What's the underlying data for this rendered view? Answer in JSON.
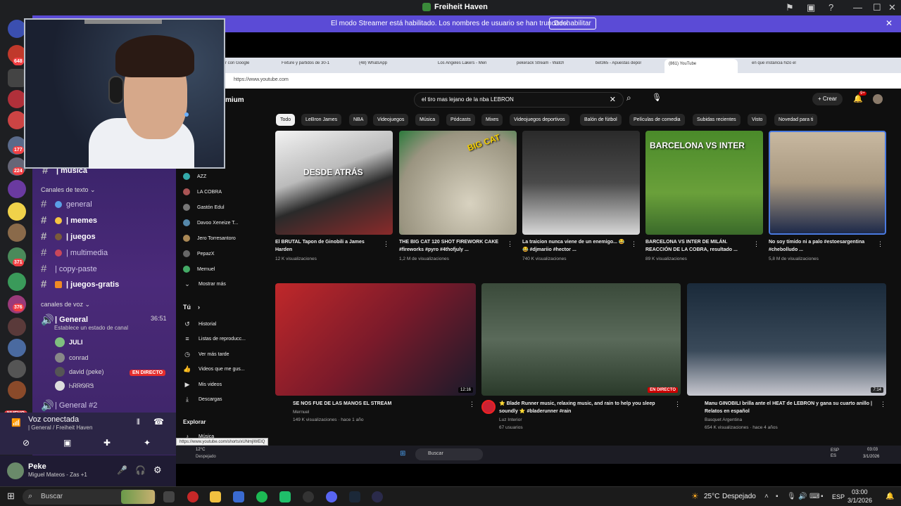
{
  "window": {
    "title": "Freiheit Haven"
  },
  "banner": {
    "text": "El modo Streamer está habilitado. Los nombres de usuario se han truncado.",
    "button": "Deshabilitar"
  },
  "servers": {
    "badges": [
      "648",
      "177",
      "224",
      "371",
      "376"
    ],
    "new_label": "NUEVO"
  },
  "channels": {
    "top_channel": "| música",
    "text_category": "Canales de texto",
    "text_channels": [
      {
        "emoji_color": "#5aa0e6",
        "label": "general"
      },
      {
        "emoji_color": "#f5c542",
        "label": "| memes"
      },
      {
        "emoji_color": "#7a5a3a",
        "label": "| juegos"
      },
      {
        "emoji_color": "#c9475a",
        "label": "| multimedia"
      },
      {
        "emoji_color": "#777777",
        "label": "| copy-paste"
      },
      {
        "emoji_color": "#f08a24",
        "label": "| juegos-gratis"
      }
    ],
    "voice_category": "canales de voz",
    "voice_channel": "| General",
    "voice_timer": "36:51",
    "voice_status": "Establece un estado de canal",
    "voice_users": [
      {
        "name": "JULI",
        "color": "#7fbf7f"
      },
      {
        "name": "conrad",
        "color": "#888888"
      },
      {
        "name": "david (peke)",
        "color": "#555555"
      },
      {
        "name": "ᏂᏒᏒᏫᏒᏕ",
        "color": "#dddddd"
      }
    ],
    "live_label": "EN DIRECTO",
    "voice_channel_2": "| General #2"
  },
  "voice_bar": {
    "title": "Voz conectada",
    "subtitle": "| General / Freiheit Haven"
  },
  "user_bar": {
    "name": "Peke",
    "status": "Miguel Mateos - Zas +1"
  },
  "browser": {
    "tabs": [
      "r con Google",
      "Fixture y partidos de 30-1",
      "(48) WhatsApp",
      "Los Angeles Lakers - Men",
      "pekerack Stream - Watch",
      "bet365 - Apuestas depor",
      "(861) YouTube",
      "en que instancia hizo el"
    ],
    "url": "https://www.youtube.com",
    "status_url": "https://www.youtube.com/shorts/xUNmjlWElQ"
  },
  "youtube": {
    "logo_text": "mium",
    "search_query": "el tiro mas lejano de la nba LEBRON",
    "create_label": "Crear",
    "notif_count": "9+",
    "chips": [
      "Todo",
      "LeBron James",
      "NBA",
      "Videojuegos",
      "Música",
      "Pódcasts",
      "Mixes",
      "Videojuegos deportivos",
      "Balón de fútbol",
      "Películas de comedia",
      "Subidas recientes",
      "Visto",
      "Novedad para ti"
    ],
    "subscriptions": [
      "AZZ",
      "LA COBRA",
      "Gastón Edul",
      "Davoo Xeneize T...",
      "Jero Torresantoro",
      "PepazX",
      "Mernuel"
    ],
    "show_more": "Mostrar más",
    "you_header": "Tú",
    "you_items": [
      "Historial",
      "Listas de reproducc...",
      "Ver más tarde",
      "Videos que me gus...",
      "Mis videos",
      "Descargas"
    ],
    "explore_header": "Explorar",
    "explore_items": [
      "Música"
    ],
    "shorts": [
      {
        "thumb_text": "DESDE ATRÁS",
        "title": "El BRUTAL Tapon de Ginobili a James Harden",
        "views": "12 K visualizaciones"
      },
      {
        "thumb_text": "BIG CAT",
        "title": "THE BIG CAT 120 SHOT FIREWORK CAKE #fireworks #pyro #4thofjuly ...",
        "views": "1,2 M de visualizaciones"
      },
      {
        "thumb_text": "",
        "title": "La traicion nunca viene de un enemigo... 😂 😂 #djmariio #hector ...",
        "views": "740 K visualizaciones"
      },
      {
        "thumb_text": "BARCELONA VS INTER",
        "title": "BARCELONA VS INTER DE MILÁN. REACCIÓN DE LA COBRA, resultado ...",
        "views": "89 K visualizaciones"
      },
      {
        "thumb_text": "",
        "title": "No soy tímido ni a palo #estoesargentina #chebolludo ...",
        "views": "5,8 M de visualizaciones"
      }
    ],
    "videos": [
      {
        "title": "SE NOS FUE DE LAS MANOS EL STREAM",
        "channel": "Mernuel",
        "meta": "149 K visualizaciones · hace 1 año",
        "duration": "12:16"
      },
      {
        "title": "⭐ Blade Runner music, relaxing music, and rain to help you sleep soundly ⭐ #bladerunner #rain",
        "channel": "Luz Interior",
        "meta": "67 usuarios",
        "live": "EN DIRECTO"
      },
      {
        "title": "Manu GINOBILI brilla ante el HEAT de LEBRON y gana su cuarto anillo | Relatos en español",
        "channel": "Basquet Argentina",
        "meta": "654 K visualizaciones · hace 4 años",
        "duration": "7:14"
      }
    ]
  },
  "inner_taskbar": {
    "weather_temp": "12°C",
    "weather_desc": "Despejado",
    "search": "Buscar",
    "lang": "ESP ES",
    "time": "03:03",
    "date": "3/1/2026"
  },
  "taskbar": {
    "search": "Buscar",
    "weather_temp": "25°C",
    "weather_desc": "Despejado",
    "lang": "ESP",
    "time": "03:00",
    "date": "3/1/2026"
  }
}
